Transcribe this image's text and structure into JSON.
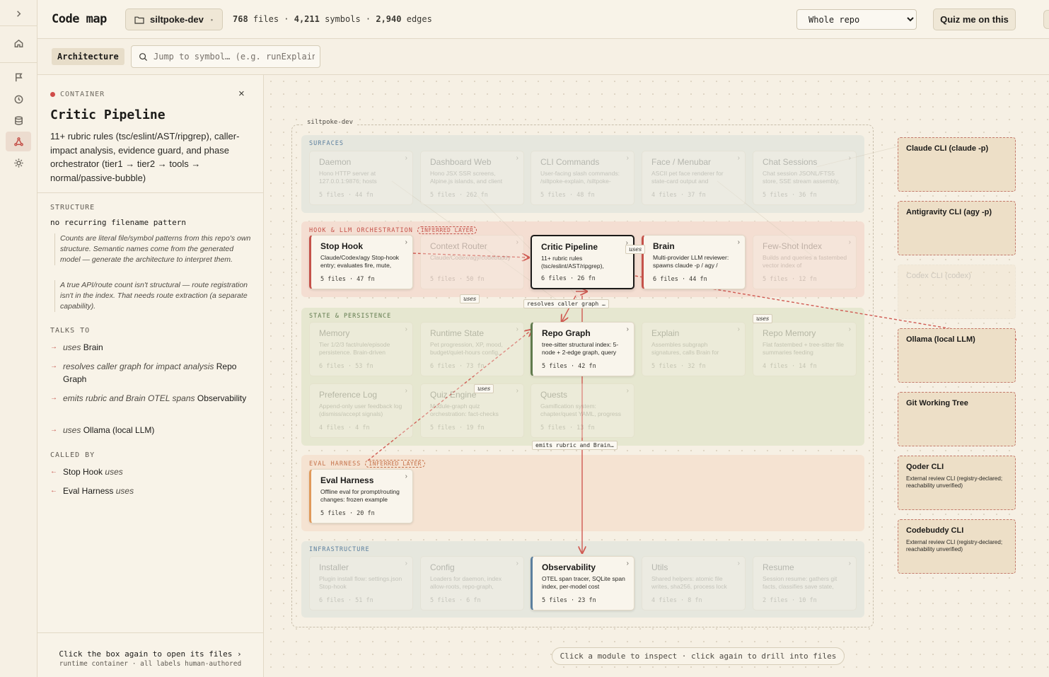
{
  "app": {
    "title": "Code map",
    "repo": "siltpoke-dev",
    "stats": {
      "files": "768",
      "files_label": "files",
      "symbols": "4,211",
      "symbols_label": "symbols",
      "edges": "2,940",
      "edges_label": "edges"
    },
    "scope": "Whole repo",
    "quiz": "Quiz me on this"
  },
  "rail": {
    "expand": "expand-icon",
    "items": [
      "home-icon",
      "flag-icon",
      "clock-icon",
      "database-icon",
      "graph-icon",
      "sun-icon"
    ],
    "active": "graph-icon"
  },
  "subbar": {
    "tab": "Architecture",
    "search_placeholder": "Jump to symbol… (e.g. runExplain"
  },
  "panel": {
    "kind": "CONTAINER",
    "title": "Critic Pipeline",
    "description": "11+ rubric rules (tsc/eslint/AST/ripgrep), caller-impact analysis, evidence guard, and phase orchestrator (tier1 → tier2 → tools → normal/passive-bubble)",
    "structure_heading": "STRUCTURE",
    "structure_value": "no recurring filename pattern",
    "notes": [
      "Counts are literal file/symbol patterns from this repo's own structure. Semantic names come from the generated model — generate the architecture to interpret them.",
      "A true API/route count isn't structural — route registration isn't in the index. That needs route extraction (a separate capability)."
    ],
    "talks_heading": "TALKS TO",
    "talks_to": [
      {
        "verb": "uses",
        "target": "Brain"
      },
      {
        "verb": "resolves caller graph for impact analysis",
        "target": "Repo Graph"
      },
      {
        "verb": "emits rubric and Brain OTEL spans",
        "target": "Observability"
      },
      {
        "verb": "uses",
        "target": "Ollama (local LLM)"
      }
    ],
    "called_heading": "CALLED BY",
    "called_by": [
      {
        "source": "Stop Hook",
        "verb": "uses"
      },
      {
        "source": "Eval Harness",
        "verb": "uses"
      }
    ],
    "footer": "Click the box again to open its files ›",
    "footer_sub": "runtime container · all labels human-authored"
  },
  "canvas": {
    "repo_label": "siltpoke-dev",
    "layers": [
      {
        "title": "SURFACES",
        "inferred": false,
        "color": "#5b7f9e"
      },
      {
        "title": "HOOK & LLM ORCHESTRATION",
        "inferred": true,
        "badge": "INFERRED LAYER",
        "color": "#c5524a"
      },
      {
        "title": "STATE & PERSISTENCE",
        "inferred": false,
        "color": "#607a4d"
      },
      {
        "title": "EVAL HARNESS",
        "inferred": true,
        "badge": "INFERRED LAYER",
        "color": "#c5724a"
      },
      {
        "title": "INFRASTRUCTURE",
        "inferred": false,
        "color": "#5b7f9e"
      }
    ],
    "boxes": [
      {
        "title": "Daemon",
        "desc": "Hono HTTP server at 127.0.0.1:9876; hosts",
        "meta": "5 files · 44 fn"
      },
      {
        "title": "Dashboard Web",
        "desc": "Hono JSX SSR screens, Alpine.js islands, and client",
        "meta": "5 files · 262 fn"
      },
      {
        "title": "CLI Commands",
        "desc": "User-facing slash commands: /siltpoke-explain, /siltpoke-",
        "meta": "5 files · 48 fn"
      },
      {
        "title": "Face / Menubar",
        "desc": "ASCII pet face renderer for state-card output and",
        "meta": "4 files · 37 fn"
      },
      {
        "title": "Chat Sessions",
        "desc": "Chat session JSONL/FTS5 store, SSE stream assembly,",
        "meta": "5 files · 36 fn"
      },
      {
        "title": "Stop Hook",
        "desc": "Claude/Codex/agy Stop-hook entry; evaluates fire, mute,",
        "meta": "5 files · 47 fn"
      },
      {
        "title": "Context Router",
        "desc": "Claude/Codex/agy/codebuddy",
        "meta": "5 files · 50 fn"
      },
      {
        "title": "Critic Pipeline",
        "desc": "11+ rubric rules (tsc/eslint/AST/ripgrep),",
        "meta": "6 files · 26 fn"
      },
      {
        "title": "Brain",
        "desc": "Multi-provider LLM reviewer: spawns claude -p / agy /",
        "meta": "6 files · 44 fn"
      },
      {
        "title": "Few-Shot Index",
        "desc": "Builds and queries a fastembed vector index of",
        "meta": "5 files · 12 fn"
      },
      {
        "title": "Memory",
        "desc": "Tier 1/2/3 fact/rule/episode persistence. Brain-driven",
        "meta": "6 files · 53 fn"
      },
      {
        "title": "Runtime State",
        "desc": "Pet progression, XP, mood, budget/quiet-hours config,",
        "meta": "6 files · 73 fn"
      },
      {
        "title": "Repo Graph",
        "desc": "tree-sitter structural index: 5-node + 2-edge graph, query",
        "meta": "5 files · 42 fn"
      },
      {
        "title": "Explain",
        "desc": "Assembles subgraph signatures, calls Brain for",
        "meta": "5 files · 32 fn"
      },
      {
        "title": "Repo Memory",
        "desc": "Flat fastembed + tree-sitter file summaries feeding",
        "meta": "4 files · 14 fn"
      },
      {
        "title": "Preference Log",
        "desc": "Append-only user feedback log (dismiss/accept signals)",
        "meta": "4 files · 4 fn"
      },
      {
        "title": "Quiz Engine",
        "desc": "Module-graph quiz orchestration: fact-checks",
        "meta": "5 files · 19 fn"
      },
      {
        "title": "Quests",
        "desc": "Gamification system: chapter/quest YAML, progress",
        "meta": "5 files · 13 fn"
      },
      {
        "title": "Eval Harness",
        "desc": "Offline eval for prompt/routing changes: frozen example",
        "meta": "5 files · 20 fn"
      },
      {
        "title": "Installer",
        "desc": "Plugin install flow: settings.json Stop-hook",
        "meta": "6 files · 51 fn"
      },
      {
        "title": "Config",
        "desc": "Loaders for daemon, index allow-roots, repo-graph,",
        "meta": "5 files · 6 fn"
      },
      {
        "title": "Observability",
        "desc": "OTEL span tracer, SQLite span index, per-model cost",
        "meta": "5 files · 23 fn"
      },
      {
        "title": "Utils",
        "desc": "Shared helpers: atomic file writes, sha256, process lock",
        "meta": "4 files · 8 fn"
      },
      {
        "title": "Resume",
        "desc": "Session resume: gathers git facts, classifies save state,",
        "meta": "2 files · 10 fn"
      }
    ],
    "externals": [
      {
        "title": "Claude CLI (claude -p)",
        "desc": ""
      },
      {
        "title": "Antigravity CLI (agy -p)",
        "desc": ""
      },
      {
        "title": "Codex CLI (codex)",
        "desc": ""
      },
      {
        "title": "Ollama (local LLM)",
        "desc": ""
      },
      {
        "title": "Git Working Tree",
        "desc": ""
      },
      {
        "title": "Qoder CLI",
        "desc": "External review CLI (registry-declared; reachability unverified)"
      },
      {
        "title": "Codebuddy CLI",
        "desc": "External review CLI (registry-declared; reachability unverified)"
      }
    ],
    "edge_labels": [
      "uses",
      "uses",
      "resolves caller graph …",
      "uses",
      "uses",
      "emits rubric and Brain…"
    ],
    "hint": "Click a module to inspect · click again to drill into files"
  }
}
